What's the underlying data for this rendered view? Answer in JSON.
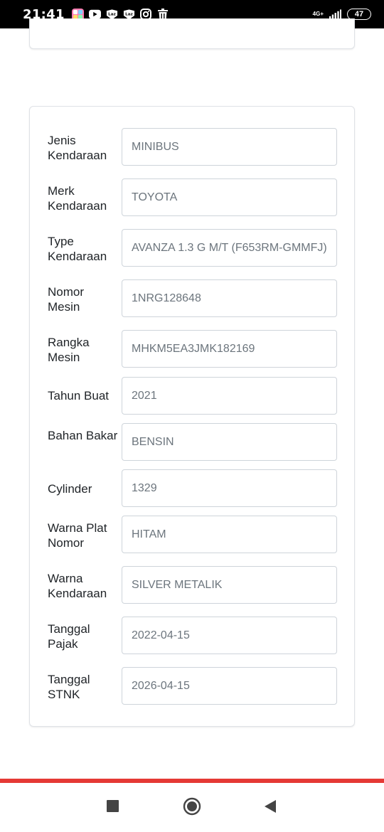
{
  "status_bar": {
    "time": "21:41",
    "network": "4G+",
    "battery": "47",
    "icons": [
      "app-icon",
      "youtube-icon",
      "lazada-icon",
      "lazada-icon",
      "instagram-icon",
      "trash-icon"
    ]
  },
  "vehicle": {
    "rows": [
      {
        "label": "Jenis Kendaraan",
        "value": "MINIBUS"
      },
      {
        "label": "Merk Kendaraan",
        "value": "TOYOTA"
      },
      {
        "label": "Type Kendaraan",
        "value": "AVANZA 1.3 G M/T (F653RM-GMMFJ)"
      },
      {
        "label": "Nomor Mesin",
        "value": "1NRG128648"
      },
      {
        "label": "Rangka Mesin",
        "value": "MHKM5EA3JMK182169"
      },
      {
        "label": "Tahun Buat",
        "value": "2021"
      },
      {
        "label": "Bahan Bakar",
        "value": "BENSIN"
      },
      {
        "label": "Cylinder",
        "value": "1329"
      },
      {
        "label": "Warna Plat Nomor",
        "value": "HITAM"
      },
      {
        "label": "Warna Kendaraan",
        "value": "SILVER METALIK"
      },
      {
        "label": "Tanggal Pajak",
        "value": "2022-04-15"
      },
      {
        "label": "Tanggal STNK",
        "value": "2026-04-15"
      }
    ]
  },
  "nav": {
    "buttons": [
      "recent-apps",
      "home",
      "back"
    ]
  },
  "colors": {
    "accent_line": "#e53935",
    "field_text": "#6c757d",
    "label_text": "#212529",
    "border": "#ced4da"
  }
}
